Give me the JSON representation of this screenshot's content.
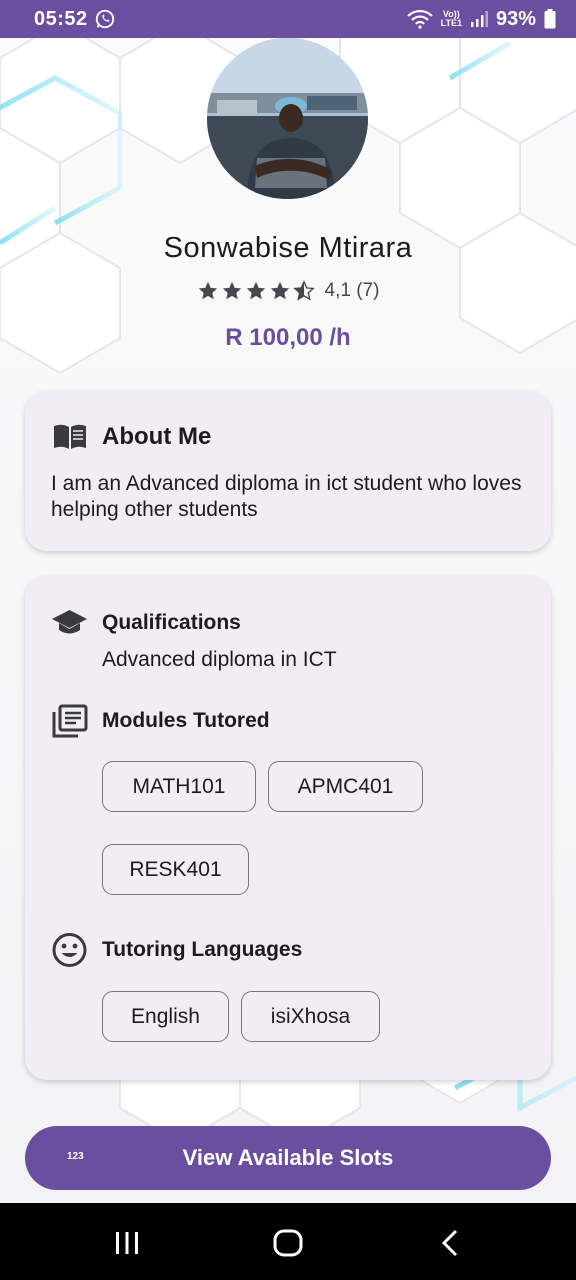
{
  "status_bar": {
    "time": "05:52",
    "network": "Vo))\nLTE1",
    "battery": "93%"
  },
  "profile": {
    "name": "Sonwabise Mtirara",
    "rating_text": "4,1 (7)",
    "rating_value": 4.1,
    "rating_max": 5,
    "price": "R 100,00 /h"
  },
  "about": {
    "title": "About Me",
    "text": "I am an Advanced diploma in ict student who loves helping other students",
    "icon": "open-book-icon"
  },
  "qualifications": {
    "title": "Qualifications",
    "value": "Advanced diploma in ICT",
    "icon": "graduation-cap-icon"
  },
  "modules": {
    "title": "Modules Tutored",
    "icon": "library-books-icon",
    "items": [
      "MATH101",
      "APMC401",
      "RESK401"
    ]
  },
  "languages": {
    "title": "Tutoring Languages",
    "icon": "smiley-face-icon",
    "items": [
      "English",
      "isiXhosa"
    ]
  },
  "cta": {
    "label": "View Available Slots",
    "keyboard_hint": "123"
  },
  "colors": {
    "accent": "#6a4fa0",
    "card_bg": "#f2edf4",
    "nav_bg": "#000000"
  }
}
